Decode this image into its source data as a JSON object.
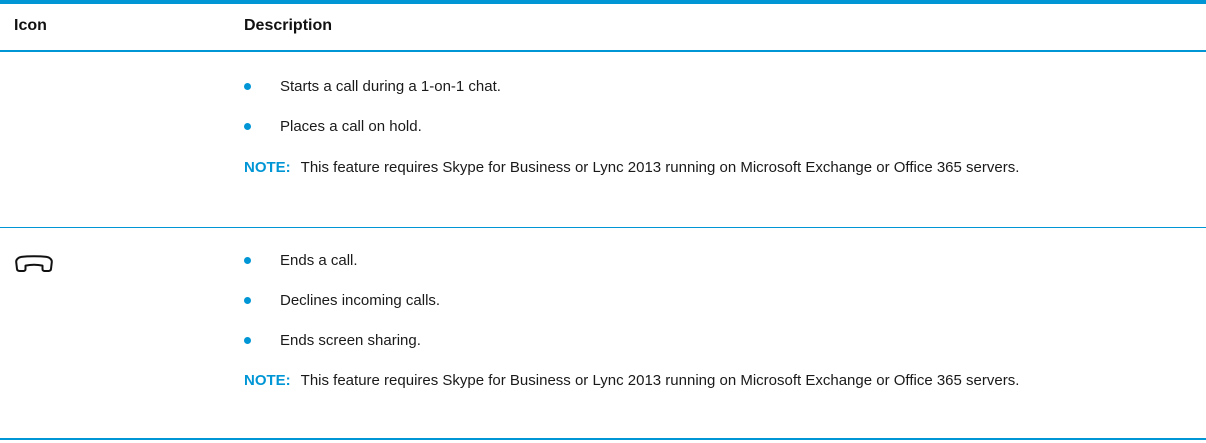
{
  "table": {
    "header": {
      "icon": "Icon",
      "description": "Description"
    },
    "rows": [
      {
        "icon": "",
        "bullets": [
          "Starts a call during a 1-on-1 chat.",
          "Places a call on hold."
        ],
        "note_label": "NOTE:",
        "note_text": "This feature requires Skype for Business or Lync 2013 running on Microsoft Exchange or Office 365 servers."
      },
      {
        "icon": "end-call-handset-icon",
        "bullets": [
          "Ends a call.",
          "Declines incoming calls.",
          "Ends screen sharing."
        ],
        "note_label": "NOTE:",
        "note_text": "This feature requires Skype for Business or Lync 2013 running on Microsoft Exchange or Office 365 servers."
      }
    ]
  },
  "colors": {
    "accent": "#0096d6",
    "text": "#1a1a1a"
  }
}
